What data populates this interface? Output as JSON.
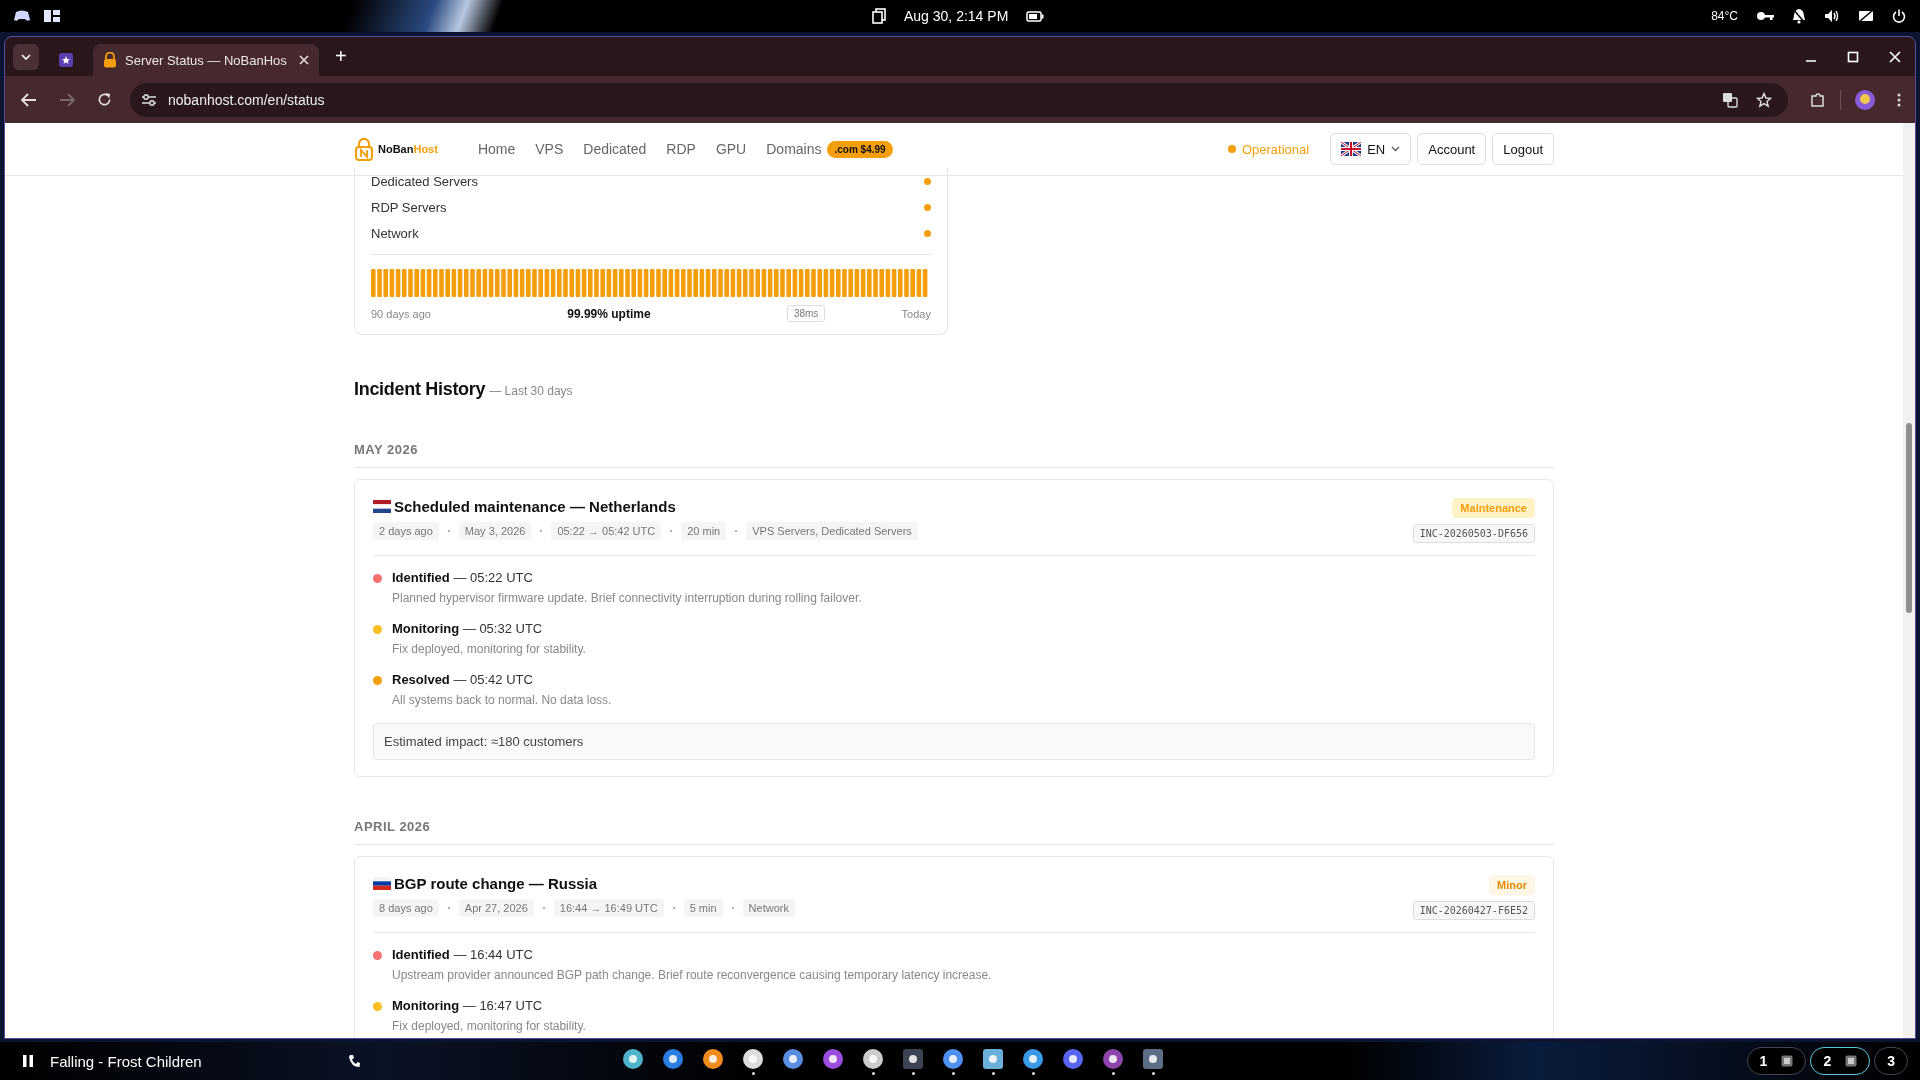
{
  "system_bar": {
    "datetime": "Aug 30, 2:14 PM",
    "temperature": "84°C"
  },
  "browser": {
    "tabs": [
      {
        "kind": "pinned",
        "selected": false
      },
      {
        "kind": "page",
        "title": "Server Status — NoBanHos",
        "selected": true
      }
    ],
    "new_tab": "+",
    "url": "nobanhost.com/en/status"
  },
  "header": {
    "logo_primary": "NoBan",
    "logo_accent": "Host",
    "nav": [
      "Home",
      "VPS",
      "Dedicated",
      "RDP",
      "GPU",
      "Domains"
    ],
    "domain_badge": ".com $4.99",
    "status": "Operational",
    "language": "EN",
    "buttons": [
      "Account",
      "Logout"
    ]
  },
  "services": [
    {
      "name": "Dedicated Servers"
    },
    {
      "name": "RDP Servers"
    },
    {
      "name": "Network"
    }
  ],
  "uptime": {
    "start": "90 days ago",
    "summary": "99.99% uptime",
    "latency": "38ms",
    "end": "Today"
  },
  "incident_history": {
    "title": "Incident History",
    "subtitle": "— Last 30 days"
  },
  "months": [
    {
      "label": "MAY 2026",
      "incidents": [
        {
          "flag": {
            "kind": "netherlands"
          },
          "title": "Scheduled maintenance — Netherlands",
          "badge": {
            "label": "Maintenance",
            "kind": "maintenance"
          },
          "meta": [
            "2 days ago",
            "May 3, 2026",
            "05:22 → 05:42 UTC",
            "20 min",
            "VPS Servers, Dedicated Servers"
          ],
          "id": "INC-20260503-DF656",
          "updates": [
            {
              "stage": "Identified",
              "time": "— 05:22 UTC",
              "text": "Planned hypervisor firmware update. Brief connectivity interruption during rolling failover.",
              "color": "#f87171"
            },
            {
              "stage": "Monitoring",
              "time": "— 05:32 UTC",
              "text": "Fix deployed, monitoring for stability.",
              "color": "#fbbf24"
            },
            {
              "stage": "Resolved",
              "time": "— 05:42 UTC",
              "text": "All systems back to normal. No data loss.",
              "color": "#f59e0b"
            }
          ],
          "impact": "Estimated impact: ≈180 customers"
        }
      ]
    },
    {
      "label": "APRIL 2026",
      "incidents": [
        {
          "flag": {
            "kind": "russia"
          },
          "title": "BGP route change — Russia",
          "badge": {
            "label": "Minor",
            "kind": "minor"
          },
          "meta": [
            "8 days ago",
            "Apr 27, 2026",
            "16:44 → 16:49 UTC",
            "5 min",
            "Network"
          ],
          "id": "INC-20260427-F6E52",
          "updates": [
            {
              "stage": "Identified",
              "time": "— 16:44 UTC",
              "text": "Upstream provider announced BGP path change. Brief route reconvergence causing temporary latency increase.",
              "color": "#f87171"
            },
            {
              "stage": "Monitoring",
              "time": "— 16:47 UTC",
              "text": "Fix deployed, monitoring for stability.",
              "color": "#fbbf24"
            }
          ]
        }
      ]
    }
  ],
  "taskbar": {
    "now_playing": "Falling - Frost Children",
    "apps": [
      {
        "kind": "camera",
        "running": false
      },
      {
        "kind": "chat",
        "running": false
      },
      {
        "kind": "cone",
        "running": false
      },
      {
        "kind": "ring",
        "running": true
      },
      {
        "kind": "gear",
        "running": false
      },
      {
        "kind": "orb",
        "running": false
      },
      {
        "kind": "pen",
        "running": true
      },
      {
        "kind": "terminal",
        "running": true
      },
      {
        "kind": "browser",
        "running": true
      },
      {
        "kind": "notes",
        "running": true
      },
      {
        "kind": "bubble",
        "running": true
      },
      {
        "kind": "controller",
        "running": false
      },
      {
        "kind": "cat",
        "running": true
      },
      {
        "kind": "monitor",
        "running": true
      }
    ],
    "workspaces": [
      {
        "label": "1",
        "selected": false,
        "windows": true
      },
      {
        "label": "2",
        "selected": true,
        "windows": true
      },
      {
        "label": "3",
        "selected": false,
        "windows": false
      }
    ]
  }
}
